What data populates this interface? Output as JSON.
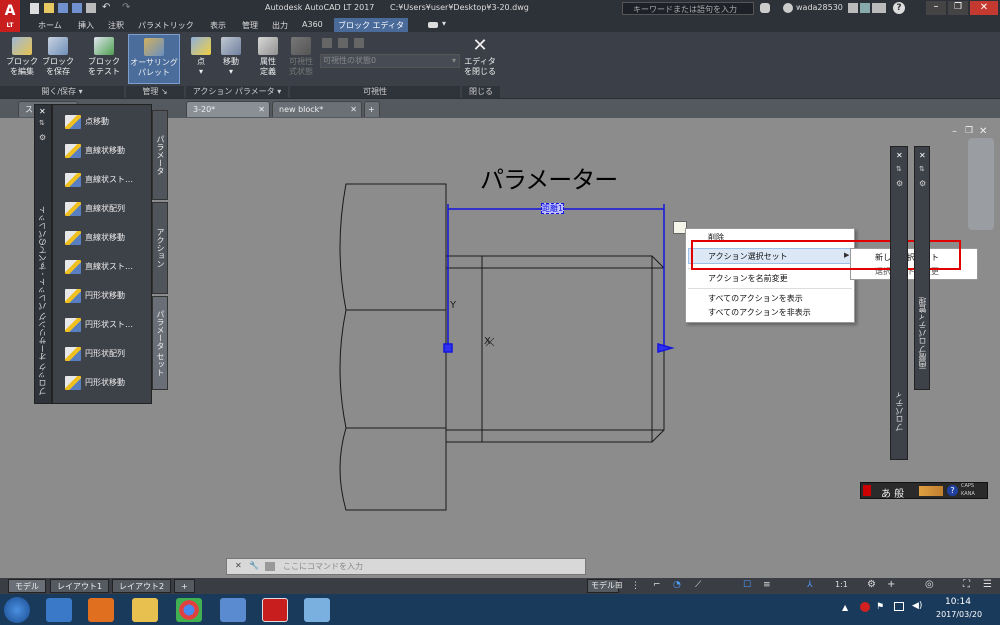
{
  "app": {
    "logo_letter": "A",
    "logo_sub": "LT",
    "window_title": "Autodesk AutoCAD LT 2017",
    "file_path": "C:¥Users¥user¥Desktop¥3-20.dwg",
    "search_placeholder": "キーワードまたは語句を入力",
    "user": "wada28530"
  },
  "ribbon_tabs": [
    "ホーム",
    "挿入",
    "注釈",
    "パラメトリック",
    "表示",
    "管理",
    "出力",
    "A360",
    "ブロック エディタ"
  ],
  "ribbon": {
    "buttons": [
      {
        "label1": "ブロック",
        "label2": "を編集"
      },
      {
        "label1": "ブロック",
        "label2": "を保存"
      },
      {
        "label1": "ブロック",
        "label2": "をテスト"
      },
      {
        "label1": "オーサリング",
        "label2": "パレット"
      },
      {
        "label1": "点",
        "label2": ""
      },
      {
        "label1": "移動",
        "label2": ""
      },
      {
        "label1": "属性",
        "label2": "定義"
      },
      {
        "label1": "可視性",
        "label2": "式状態"
      },
      {
        "label1": "エディタ",
        "label2": "を閉じる"
      }
    ],
    "visibility_state": "可視性の状態0",
    "panels": [
      "開く/保存",
      "管理",
      "アクション パラメータ",
      "可視性",
      "閉じる"
    ]
  },
  "doc_tabs": [
    "スタ",
    "3-20*",
    "new block*"
  ],
  "palette": {
    "title": "ブロック オーサリング パレット - すべてのパレット",
    "items": [
      "点移動",
      "直線状移動",
      "直線状スト…",
      "直線状配列",
      "直線状移動",
      "直線状スト…",
      "円形状移動",
      "円形状スト…",
      "円形状配列",
      "円形状移動"
    ],
    "tabs": [
      "パラメータ",
      "アクション",
      "パラメータ セット"
    ]
  },
  "drawing": {
    "heading": "パラメーター",
    "param_label": "距離1",
    "y_label": "Y",
    "x_label": "X"
  },
  "context_menu": {
    "items": [
      "削除",
      "アクション選択セット",
      "アクションを名前変更",
      "すべてのアクションを表示",
      "すべてのアクションを非表示"
    ],
    "submenu": [
      "新しい選択セット",
      "選択セットを変更"
    ]
  },
  "properties": {
    "title": "プロパティ",
    "title2": "画層プロパティ管理"
  },
  "command_line": {
    "placeholder": "ここにコマンドを入力"
  },
  "layout_tabs": [
    "モデル",
    "レイアウト1",
    "レイアウト2"
  ],
  "status": {
    "model": "モデル",
    "scale": "1:1"
  },
  "ime": {
    "mode": "あ 般",
    "caps": "CAPS",
    "kana": "KANA"
  },
  "clock": {
    "time": "10:14",
    "date": "2017/03/20"
  }
}
